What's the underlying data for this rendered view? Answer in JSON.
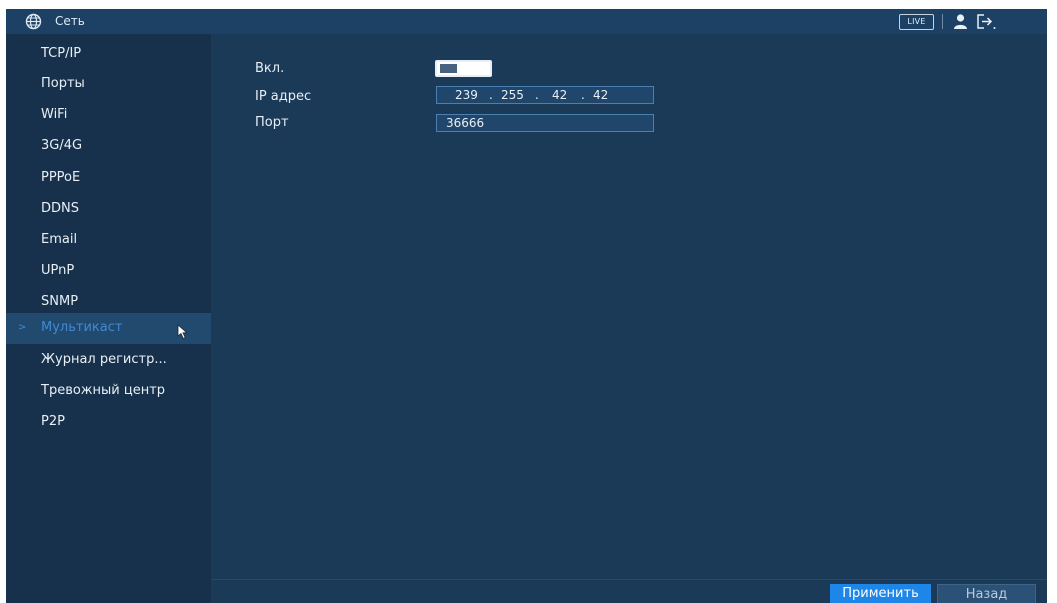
{
  "titlebar": {
    "title": "Сеть",
    "live_label": "LIVE",
    "icons": [
      "globe-icon",
      "user-icon",
      "logout-icon"
    ]
  },
  "sidebar": {
    "items": [
      {
        "label": "TCP/IP"
      },
      {
        "label": "Порты"
      },
      {
        "label": "WiFi"
      },
      {
        "label": "3G/4G"
      },
      {
        "label": "PPPoE"
      },
      {
        "label": "DDNS"
      },
      {
        "label": "Email"
      },
      {
        "label": "UPnP"
      },
      {
        "label": "SNMP"
      },
      {
        "label": "Мультикаст",
        "active": true
      },
      {
        "label": "Журнал регистр..."
      },
      {
        "label": "Тревожный центр"
      },
      {
        "label": "P2P"
      }
    ],
    "active_marker": ">"
  },
  "form": {
    "enable_label": "Вкл.",
    "enable_value": true,
    "ip_label": "IP адрес",
    "ip_segments": [
      "239",
      "255",
      "42",
      "42"
    ],
    "ip_dot": ".",
    "port_label": "Порт",
    "port_value": "36666"
  },
  "footer": {
    "apply_label": "Применить",
    "back_label": "Назад"
  },
  "colors": {
    "background": "#1b3a58",
    "sidebar": "#17314c",
    "accent": "#1d86e8",
    "active_text": "#3f8ad6"
  }
}
